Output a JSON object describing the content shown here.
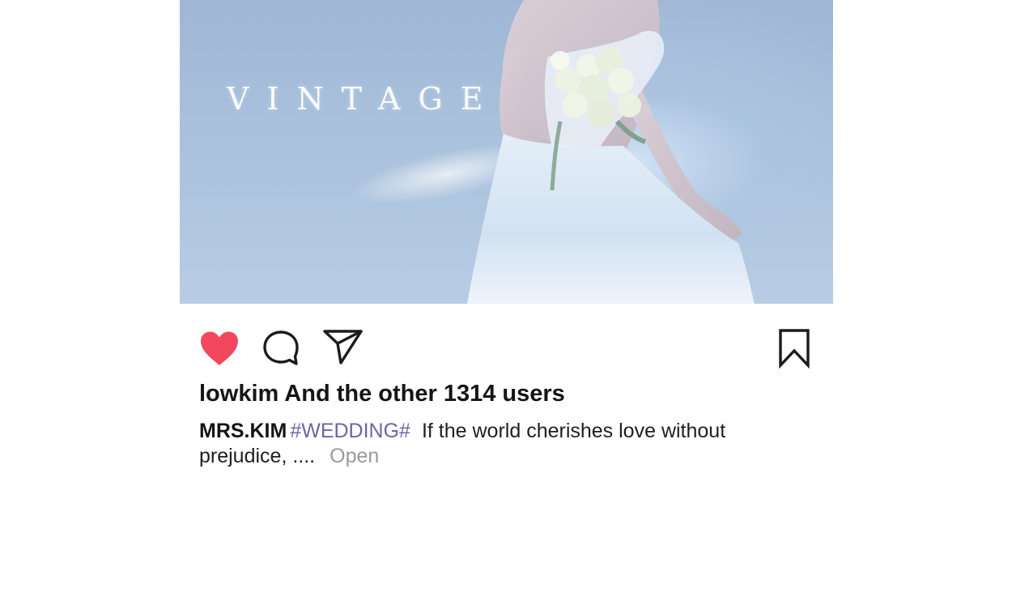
{
  "post": {
    "image": {
      "overlay_text": "VINTAGE"
    },
    "actions": {
      "like_icon": "heart-filled-icon",
      "comment_icon": "speech-bubble-icon",
      "share_icon": "paper-plane-icon",
      "bookmark_icon": "bookmark-icon",
      "like_color": "#f2475c"
    },
    "likes_text": "lowkim And the other 1314 users",
    "caption": {
      "username": "MRS.KIM",
      "hashtag": "#WEDDING#",
      "text": "If the world cherishes love without prejudice, ....",
      "more_label": "Open"
    }
  }
}
